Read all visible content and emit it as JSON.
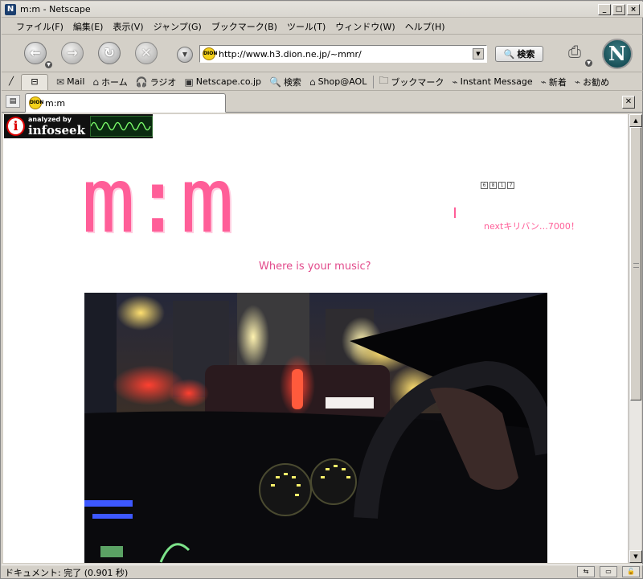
{
  "window": {
    "title": "m:m - Netscape",
    "controls": {
      "minimize": "_",
      "maximize": "□",
      "close": "×"
    }
  },
  "menu": [
    "ファイル(F)",
    "編集(E)",
    "表示(V)",
    "ジャンプ(G)",
    "ブックマーク(B)",
    "ツール(T)",
    "ウィンドウ(W)",
    "ヘルプ(H)"
  ],
  "navigation": {
    "back_icon": "back-arrow-icon",
    "forward_icon": "forward-arrow-icon",
    "reload_icon": "reload-icon",
    "stop_icon": "stop-icon",
    "url": "http://www.h3.dion.ne.jp/~mmr/",
    "search_label": "検索"
  },
  "personal_toolbar": [
    {
      "label": "Mail",
      "icon": "mail-icon"
    },
    {
      "label": "ホーム",
      "icon": "home-icon"
    },
    {
      "label": "ラジオ",
      "icon": "radio-icon"
    },
    {
      "label": "Netscape.co.jp",
      "icon": "my-netscape-icon"
    },
    {
      "label": "検索",
      "icon": "search-icon"
    },
    {
      "label": "Shop@AOL",
      "icon": "shop-icon"
    },
    {
      "label": "ブックマーク",
      "icon": "bookmark-folder-icon"
    },
    {
      "label": "Instant Message",
      "icon": "link-icon"
    },
    {
      "label": "新着",
      "icon": "link-icon"
    },
    {
      "label": "お勧め",
      "icon": "link-icon"
    }
  ],
  "tab": {
    "label": "m:m"
  },
  "page": {
    "infoseek_small": "analyzed by",
    "infoseek_big": "infoseek",
    "logo_text": "m:m",
    "counter_digits": [
      "6",
      "8",
      "1",
      "7"
    ],
    "kiriban_text": "nextキリバン…7000！",
    "tagline": "Where is your music?",
    "colors": {
      "accent_pink": "#ff5e98",
      "tagline_pink": "#e24a8b"
    }
  },
  "status": {
    "text": "ドキュメント: 完了 (0.901 秒)"
  }
}
